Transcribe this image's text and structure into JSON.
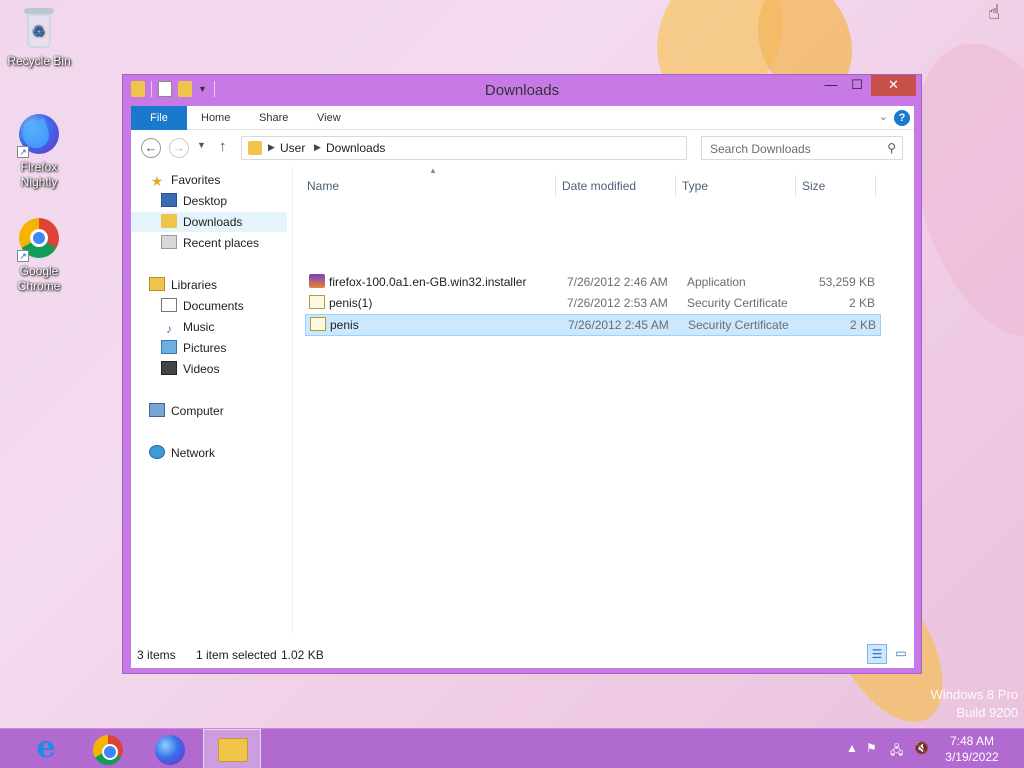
{
  "desktop": {
    "icons": [
      {
        "label": "Recycle Bin",
        "icon": "recycle-bin-icon"
      },
      {
        "label": "Firefox Nightly",
        "icon": "firefox-nightly-icon"
      },
      {
        "label": "Google Chrome",
        "icon": "chrome-icon"
      }
    ],
    "watermark_line1": "Windows 8 Pro",
    "watermark_line2": "Build 9200"
  },
  "window": {
    "title": "Downloads",
    "ribbon_tabs": [
      "File",
      "Home",
      "Share",
      "View"
    ],
    "address": {
      "crumbs": [
        "User",
        "Downloads"
      ]
    },
    "search": {
      "placeholder": "Search Downloads"
    },
    "nav": {
      "favorites": {
        "label": "Favorites",
        "items": [
          "Desktop",
          "Downloads",
          "Recent places"
        ],
        "selected": "Downloads"
      },
      "libraries": {
        "label": "Libraries",
        "items": [
          "Documents",
          "Music",
          "Pictures",
          "Videos"
        ]
      },
      "computer": {
        "label": "Computer"
      },
      "network": {
        "label": "Network"
      }
    },
    "columns": [
      "Name",
      "Date modified",
      "Type",
      "Size"
    ],
    "files": [
      {
        "name": "firefox-100.0a1.en-GB.win32.installer",
        "date": "7/26/2012 2:46 AM",
        "type": "Application",
        "size": "53,259 KB",
        "icon": "installer-icon"
      },
      {
        "name": "penis(1)",
        "date": "7/26/2012 2:53 AM",
        "type": "Security Certificate",
        "size": "2 KB",
        "icon": "certificate-icon"
      },
      {
        "name": "penis",
        "date": "7/26/2012 2:45 AM",
        "type": "Security Certificate",
        "size": "2 KB",
        "icon": "certificate-icon",
        "selected": true
      }
    ],
    "status": {
      "items": "3 items",
      "selected": "1 item selected",
      "selected_size": "1.02 KB"
    }
  },
  "taskbar": {
    "apps": [
      "Internet Explorer",
      "Google Chrome",
      "Firefox Nightly",
      "File Explorer"
    ],
    "active": "File Explorer",
    "clock": {
      "time": "7:48 AM",
      "date": "3/19/2022"
    }
  },
  "colors": {
    "accent": "#b16ad0",
    "window_frame": "#c77ae6",
    "file_tab": "#1979ca",
    "selection": "#cce8ff",
    "close_button": "#c7504a"
  }
}
